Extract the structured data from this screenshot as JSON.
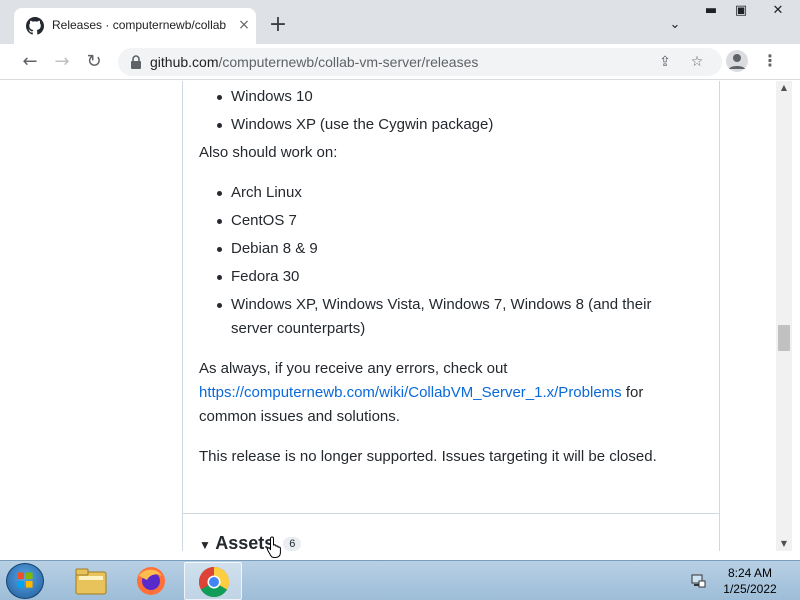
{
  "browser": {
    "tab_title": "Releases · computernewb/collab",
    "tab_close": "×",
    "new_tab": "+",
    "url_host": "github.com",
    "url_path": "/computernewb/collab-vm-server/releases"
  },
  "content": {
    "bullets_top": [
      "Windows 10",
      "Windows XP (use the Cygwin package)"
    ],
    "also_work_label": "Also should work on:",
    "bullets_also": [
      "Arch Linux",
      "CentOS 7",
      "Debian 8 & 9",
      "Fedora 30",
      "Windows XP, Windows Vista, Windows 7, Windows 8 (and their server counterparts)"
    ],
    "errors_prefix": "As always, if you receive any errors, check out",
    "errors_link": "https://computernewb.com/wiki/CollabVM_Server_1.x/Problems",
    "errors_suffix": " for common issues and solutions.",
    "unsupported": "This release is no longer supported. Issues targeting it will be closed.",
    "assets_label": "Assets",
    "assets_count": "6"
  },
  "taskbar": {
    "time": "8:24 AM",
    "date": "1/25/2022"
  },
  "colors": {
    "link": "#0969da",
    "text": "#24292f",
    "tabstrip": "#dee1e6"
  },
  "icons": [
    "github-icon",
    "lock-icon",
    "share-icon",
    "star-icon",
    "profile-icon",
    "menu-icon",
    "back-icon",
    "forward-icon",
    "reload-icon",
    "windows-start-icon",
    "file-explorer-icon",
    "firefox-icon",
    "chrome-icon",
    "network-icon"
  ]
}
